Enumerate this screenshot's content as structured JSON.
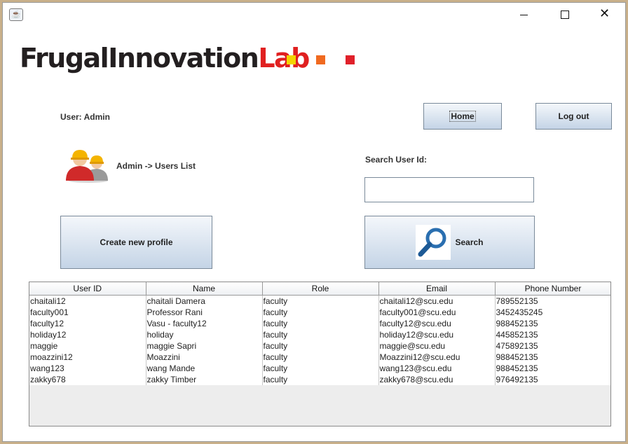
{
  "window": {
    "min_glyph": "",
    "max_glyph": "",
    "close_glyph": "✕",
    "app_icon": "java-app-icon"
  },
  "logo": {
    "text_main": "FrugalInnovation",
    "text_lab": "Lab",
    "colors": [
      "#f3d400",
      "#f06a20",
      "#e0202a"
    ]
  },
  "header": {
    "user_label": "User: Admin",
    "home_label": "Home",
    "logout_label": "Log out"
  },
  "section": {
    "breadcrumb": "Admin -> Users List",
    "icon": "users-icon"
  },
  "search": {
    "label": "Search User Id:",
    "value": "",
    "button_label": "Search",
    "icon": "magnifier-icon"
  },
  "actions": {
    "create_label": "Create new profile"
  },
  "table": {
    "headers": [
      "User ID",
      "Name",
      "Role",
      "Email",
      "Phone Number"
    ],
    "rows": [
      [
        "chaitali12",
        "chaitali Damera",
        "faculty",
        "chaitali12@scu.edu",
        "789552135"
      ],
      [
        "faculty001",
        "Professor Rani",
        "faculty",
        "faculty001@scu.edu",
        "3452435245"
      ],
      [
        "faculty12",
        "Vasu - faculty12",
        "faculty",
        "faculty12@scu.edu",
        "988452135"
      ],
      [
        "holiday12",
        "holiday",
        "faculty",
        "holiday12@scu.edu",
        "445852135"
      ],
      [
        "maggie",
        "maggie Sapri",
        "faculty",
        "maggie@scu.edu",
        "475892135"
      ],
      [
        "moazzini12",
        "Moazzini",
        "faculty",
        "Moazzini12@scu.edu",
        "988452135"
      ],
      [
        "wang123",
        "wang Mande",
        "faculty",
        "wang123@scu.edu",
        "988452135"
      ],
      [
        "zakky678",
        "zakky Timber",
        "faculty",
        "zakky678@scu.edu",
        "976492135"
      ]
    ]
  }
}
